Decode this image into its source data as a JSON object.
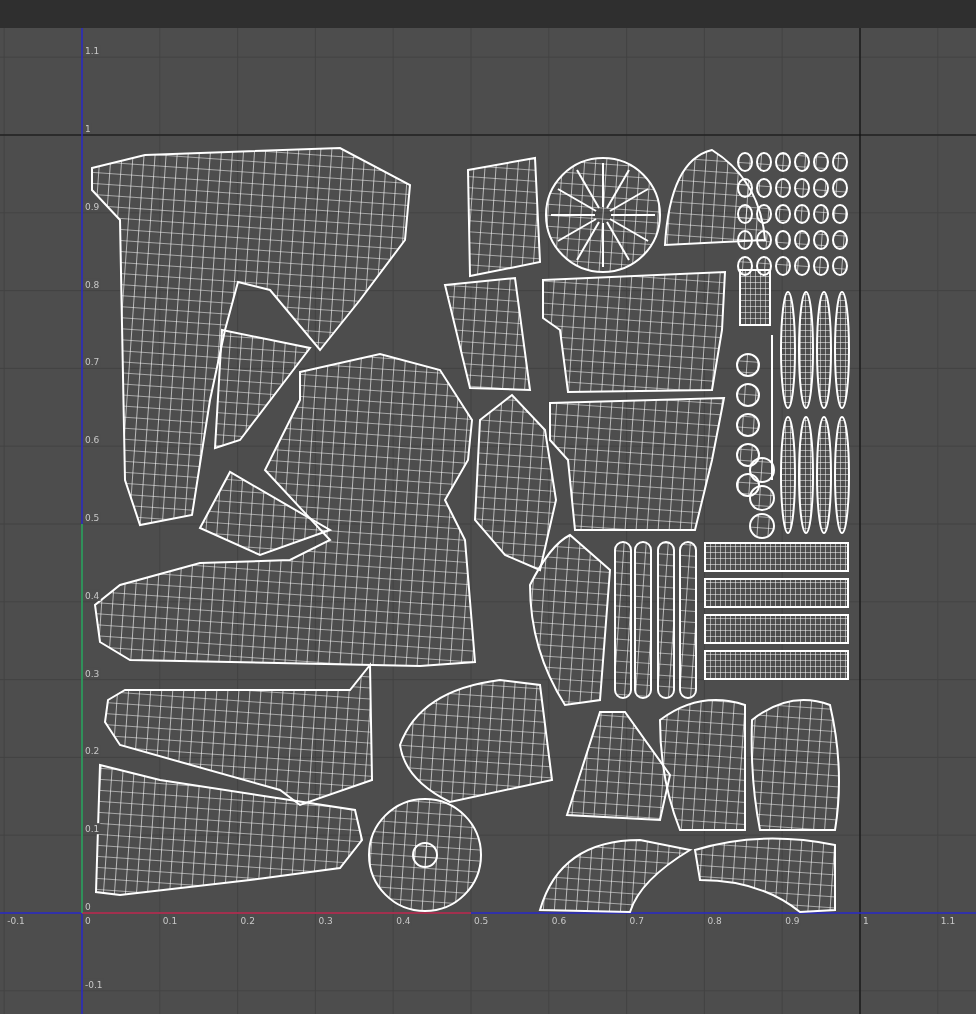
{
  "uv_editor": {
    "u_ticks": [
      "-0.1",
      "0",
      "0.1",
      "0.2",
      "0.3",
      "0.4",
      "0.5",
      "0.6",
      "0.7",
      "0.8",
      "0.9",
      "1",
      "1.1"
    ],
    "v_ticks": [
      "1.1",
      "1",
      "0.9",
      "0.8",
      "0.7",
      "0.6",
      "0.5",
      "0.4",
      "0.3",
      "0.2",
      "0.1",
      "0",
      "-0.1"
    ]
  }
}
